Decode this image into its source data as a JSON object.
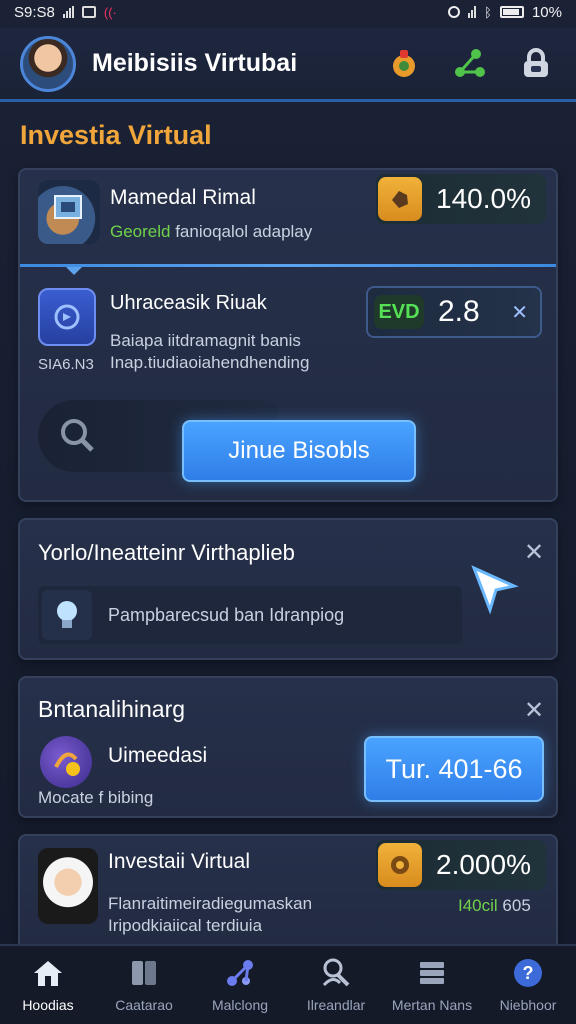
{
  "status": {
    "time": "S9:S8",
    "battery": "10%"
  },
  "header": {
    "title": "Meibisiis Virtubai",
    "icons": [
      "gear-badge-icon",
      "share-icon",
      "lock-icon"
    ]
  },
  "section": {
    "title": "Investia Virtual"
  },
  "card1": {
    "item1": {
      "title": "Mamedal Rimal",
      "sub_green": "Georeld",
      "sub_rest": " fanioqalol adaplay",
      "chip_value": "140.0%",
      "chip_icon": "fist-icon"
    },
    "item2": {
      "title": "Uhraceasik Riuak",
      "line1": "Baiapa iitdramagnit banis",
      "line2": "Inap.tiudiaoiahendhending",
      "side_label": "SIA6.N3",
      "chip_badge": "EVD",
      "chip_value": "2.8"
    },
    "button_label": "Jinue Bisobls"
  },
  "card2": {
    "title": "Yorlo/Ineatteinr Virthaplieb",
    "box_text": "Pampbarecsud ban Idranpiog",
    "box_icon": "lightbulb-icon",
    "pointer_icon": "cursor-icon"
  },
  "card3": {
    "title": "Bntanalihinarg",
    "item_title": "Uimeedasi",
    "item_sub": "Mocate f bibing",
    "button_label": "Tur. 401-66"
  },
  "card4": {
    "title": "Investaii Virtual",
    "line1": "Flanraitimeiradiegumaskan",
    "line2": "Iripodkiaiical terdiuia",
    "chip_value": "2.000%",
    "chip_icon": "coin-icon",
    "foot_green": "I40cil",
    "foot_rest": " 605"
  },
  "tabs": [
    {
      "label": "Hoodias",
      "icon": "home-icon",
      "active": true
    },
    {
      "label": "Caatarao",
      "icon": "book-icon",
      "active": false
    },
    {
      "label": "Malclong",
      "icon": "network-icon",
      "active": false
    },
    {
      "label": "Ilreandlar",
      "icon": "search-person-icon",
      "active": false
    },
    {
      "label": "Mertan Nans",
      "icon": "stack-icon",
      "active": false
    },
    {
      "label": "Niebhoor",
      "icon": "help-icon",
      "active": false
    }
  ],
  "colors": {
    "accent": "#2f7ee8",
    "section_title": "#f0a63a",
    "positive": "#6fd24a",
    "background": "#1b2236"
  }
}
